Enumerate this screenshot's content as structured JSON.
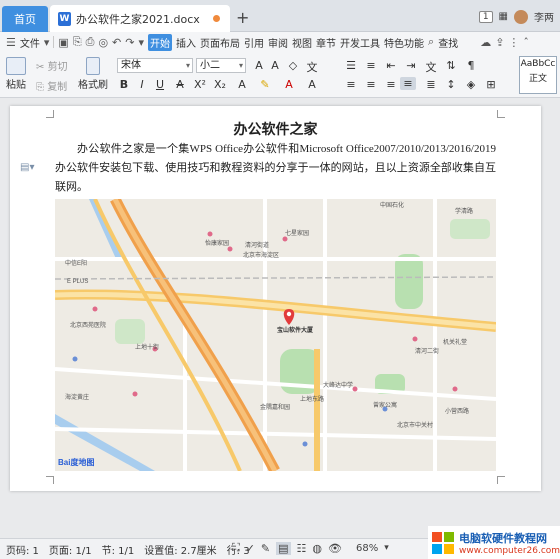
{
  "tabs": {
    "home": "首页",
    "doc_title": "办公软件之家2021.docx",
    "add": "+"
  },
  "titlebar": {
    "badge": "1",
    "user": "李两"
  },
  "menu": {
    "file": "文件",
    "items": [
      "开始",
      "插入",
      "页面布局",
      "引用",
      "审阅",
      "视图",
      "章节",
      "开发工具",
      "特色功能"
    ],
    "search": "查找"
  },
  "ribbon": {
    "paste": "粘贴",
    "cut": "剪切",
    "copy": "复制",
    "format_painter": "格式刷",
    "font_name": "宋体",
    "font_size": "小二",
    "style_preview": "AaBbCc",
    "style_name": "正文"
  },
  "document": {
    "title": "办公软件之家",
    "paragraph": "办公软件之家是一个集WPS Office办公软件和Microsoft Office2007/2010/2013/2016/2019办公软件安装包下载、使用技巧和教程资料的分享于一体的网站，且以上资源全部收集自互联网。"
  },
  "map": {
    "labels": [
      "中国石化",
      "七星家园",
      "怡康家园",
      "清河街道",
      "北京市海淀区",
      "中信E阳",
      "E PLUS",
      "北京西苑医院",
      "海淀黄庄",
      "上地十街",
      "宝山软件大厦",
      "清河二街",
      "大峰达中学",
      "曾家公寓",
      "金隅嘉和园",
      "上地东路",
      "北京市中关村",
      "机关礼堂",
      "小营西路",
      "学清路"
    ],
    "brand": "Bai度地图"
  },
  "status": {
    "page": "页码: 1",
    "pages": "页面: 1/1",
    "section": "节: 1/1",
    "position": "设置值: 2.7厘米",
    "line": "行: 3",
    "zoom": "68%"
  },
  "watermark": {
    "name": "电脑软硬件教程网",
    "url": "www.computer26.com"
  },
  "colors": {
    "accent": "#3f8fe0",
    "road_major": "#f7c96a",
    "road_orange": "#f0a04b",
    "park": "#b8e0b0",
    "water": "#a8cdee"
  }
}
